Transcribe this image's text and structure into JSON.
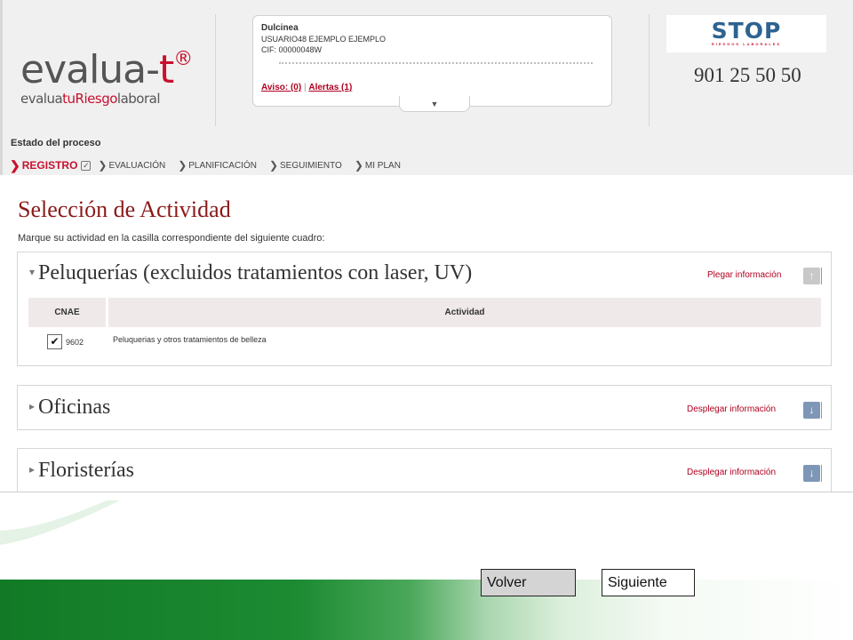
{
  "brand": {
    "logo_main_prefix": "evalua-",
    "logo_main_accent": "t",
    "logo_main_mark": "®",
    "logo_sub_1": "evalua",
    "logo_sub_2": "tuRiesgo",
    "logo_sub_3": "laboral"
  },
  "user": {
    "name": "Dulcinea",
    "user_line": "USUARIO48 EJEMPLO EJEMPLO",
    "cif_line": "CIF: 00000048W",
    "aviso_label": "Aviso: (0)",
    "separator": "|",
    "alertas_label": "Alertas (1)",
    "expand_glyph": "▼"
  },
  "partner": {
    "logo_word": "STOP",
    "logo_sub": "RIESGOS LABORALES",
    "phone": "901 25 50 50"
  },
  "process": {
    "title": "Estado del proceso",
    "steps": [
      {
        "label": "REGISTRO",
        "active": true
      },
      {
        "label": "EVALUACIÓN",
        "active": false
      },
      {
        "label": "PLANIFICACIÓN",
        "active": false
      },
      {
        "label": "SEGUIMIENTO",
        "active": false
      },
      {
        "label": "MI PLAN",
        "active": false
      }
    ],
    "chevron_glyph": "❯",
    "done_glyph": "✓"
  },
  "main": {
    "title": "Selección de Actividad",
    "instructions": "Marque su actividad en la casilla correspondiente del siguiente cuadro:",
    "panels": [
      {
        "title": "Peluquerías (excluidos tratamientos con laser, UV)",
        "toggle_label": "Plegar información",
        "expanded": true,
        "table": {
          "headers": [
            "CNAE",
            "Actividad"
          ],
          "rows": [
            {
              "checked": true,
              "code": "9602",
              "activity": "Peluquerias y otros tratamientos de belleza"
            }
          ]
        }
      },
      {
        "title": "Oficinas",
        "toggle_label": "Desplegar información",
        "expanded": false
      },
      {
        "title": "Floristerías",
        "toggle_label": "Desplegar información",
        "expanded": false
      }
    ],
    "expanded_glyph": "▾",
    "collapsed_glyph": "▸",
    "up_glyph": "↑",
    "down_glyph": "↓",
    "check_glyph": "✔"
  },
  "footer": {
    "back_label": "Volver",
    "next_label": "Siguiente"
  },
  "colors": {
    "brand_red": "#c8102e",
    "title_red": "#8b1a1a",
    "stop_blue": "#2d6391",
    "footer_green": "#127a26"
  }
}
